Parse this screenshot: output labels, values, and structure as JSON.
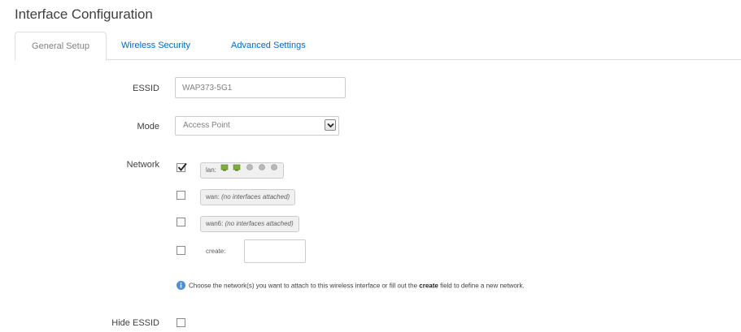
{
  "section": {
    "title": "Interface Configuration"
  },
  "tabs": [
    {
      "label": "General Setup",
      "active": true
    },
    {
      "label": "Wireless Security",
      "active": false
    },
    {
      "label": "Advanced Settings",
      "active": false
    }
  ],
  "form": {
    "essid": {
      "label": "ESSID",
      "value": "WAP373-5G1"
    },
    "mode": {
      "label": "Mode",
      "selected": "Access Point"
    },
    "network": {
      "label": "Network",
      "options": [
        {
          "name": "lan:",
          "suffix": "",
          "checked": true,
          "icons": [
            "ethernet-port-icon",
            "ethernet-port-icon",
            "wifi-port-icon",
            "wifi-port-icon",
            "wifi-port-icon"
          ]
        },
        {
          "name": "wan:",
          "suffix": "(no interfaces attached)",
          "checked": false,
          "icons": []
        },
        {
          "name": "wan6:",
          "suffix": "(no interfaces attached)",
          "checked": false,
          "icons": []
        }
      ],
      "create_label": "create:",
      "create_value": "",
      "hint_prefix": "Choose the network(s) you want to attach to this wireless interface or fill out the",
      "hint_bold": "create",
      "hint_suffix": "field to define a new network."
    },
    "hide_essid": {
      "label": "Hide ESSID",
      "checked": false
    }
  },
  "colors": {
    "link": "#0069d6",
    "info": "#4a90e2",
    "border": "#cccccc"
  }
}
